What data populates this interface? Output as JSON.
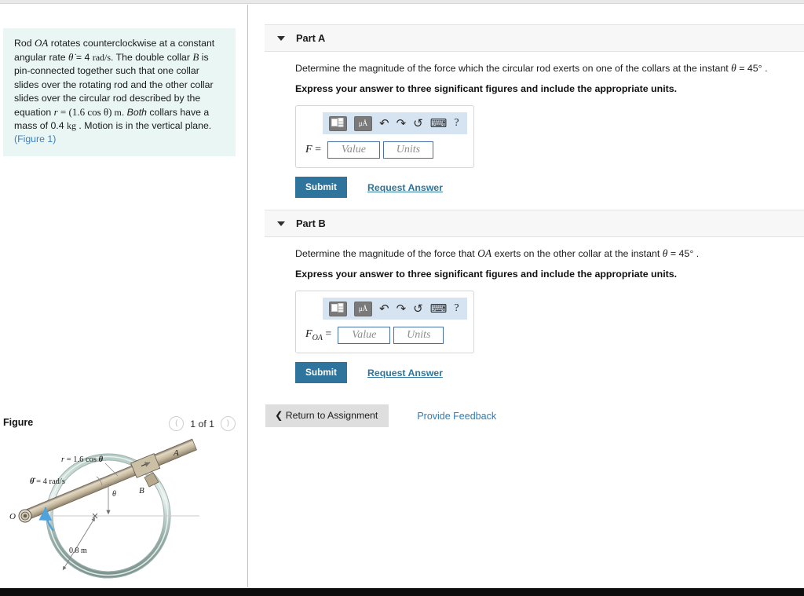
{
  "problem": {
    "text_parts": [
      {
        "t": "Rod ",
        "k": "plain"
      },
      {
        "t": "OA",
        "k": "mi"
      },
      {
        "t": " rotates counterclockwise at a constant angular rate ",
        "k": "plain"
      },
      {
        "t": "θ̇",
        "k": "mi"
      },
      {
        "t": " = 4 ",
        "k": "plain"
      },
      {
        "t": "rad/s",
        "k": "mu"
      },
      {
        "t": ". The double collar ",
        "k": "plain"
      },
      {
        "t": "B",
        "k": "mi"
      },
      {
        "t": " is pin-connected together such that one collar slides over the rotating rod and the other collar slides over the circular rod described by the equation ",
        "k": "plain"
      },
      {
        "t": "r",
        "k": "mi"
      },
      {
        "t": " = ",
        "k": "mn"
      },
      {
        "t": "(1.6 cos θ)",
        "k": "mn"
      },
      {
        "t": " m",
        "k": "mu"
      },
      {
        "t": ". ",
        "k": "plain"
      },
      {
        "t": "Both",
        "k": "em"
      },
      {
        "t": " collars have a mass of 0.4 ",
        "k": "plain"
      },
      {
        "t": "kg",
        "k": "mu"
      },
      {
        "t": " . Motion is in the vertical plane. ",
        "k": "plain"
      }
    ],
    "figure_link": "(Figure 1)"
  },
  "figure": {
    "title": "Figure",
    "counter": "1 of 1",
    "prev_icon": "chevron-left-icon",
    "next_icon": "chevron-right-icon",
    "labels": {
      "equation": "r = 1.6 cos θ",
      "angular_rate": "θ̇ = 4 rad/s",
      "origin": "O",
      "point_a": "A",
      "point_b": "B",
      "theta": "θ",
      "radius": "0.8 m"
    },
    "colors": {
      "ring_outer": "#8fa9a3",
      "ring_inner": "#d6e3de",
      "rod_fill": "#cbbfa5",
      "rod_edge": "#6b6050",
      "arrow_blue": "#4ea3dd"
    }
  },
  "parts": [
    {
      "id": "part-a",
      "label": "Part A",
      "caret_icon": "caret-down-icon",
      "question_parts": [
        {
          "t": "Determine the magnitude of the force which the circular rod exerts on one of the collars at the instant ",
          "k": "plain"
        },
        {
          "t": "θ",
          "k": "mi"
        },
        {
          "t": " = 45° .",
          "k": "plain"
        }
      ],
      "instruction": "Express your answer to three significant figures and include the appropriate units.",
      "variable": "F",
      "variable_sub": "",
      "equals": "=",
      "value_placeholder": "Value",
      "units_placeholder": "Units",
      "value": "",
      "units": "",
      "submit_label": "Submit",
      "request_answer_label": "Request Answer",
      "toolbar": [
        {
          "name": "template-layout-icon",
          "glyph": "",
          "kind": "tile"
        },
        {
          "name": "units-micro-angstrom-icon",
          "glyph": "μÅ",
          "kind": "tile"
        },
        {
          "name": "undo-icon",
          "glyph": "↶",
          "kind": "glyph"
        },
        {
          "name": "redo-icon",
          "glyph": "↷",
          "kind": "glyph"
        },
        {
          "name": "reset-icon",
          "glyph": "↺",
          "kind": "glyph"
        },
        {
          "name": "keyboard-icon",
          "glyph": "⌨",
          "kind": "glyph"
        },
        {
          "name": "help-icon",
          "glyph": "?",
          "kind": "help"
        }
      ]
    },
    {
      "id": "part-b",
      "label": "Part B",
      "caret_icon": "caret-down-icon",
      "question_parts": [
        {
          "t": "Determine the magnitude of the force that ",
          "k": "plain"
        },
        {
          "t": "OA",
          "k": "mi"
        },
        {
          "t": " exerts on the other collar at the instant ",
          "k": "plain"
        },
        {
          "t": "θ",
          "k": "mi"
        },
        {
          "t": " = 45° .",
          "k": "plain"
        }
      ],
      "instruction": "Express your answer to three significant figures and include the appropriate units.",
      "variable": "F",
      "variable_sub": "OA",
      "equals": "=",
      "value_placeholder": "Value",
      "units_placeholder": "Units",
      "value": "",
      "units": "",
      "submit_label": "Submit",
      "request_answer_label": "Request Answer",
      "toolbar": [
        {
          "name": "template-layout-icon",
          "glyph": "",
          "kind": "tile"
        },
        {
          "name": "units-micro-angstrom-icon",
          "glyph": "μÅ",
          "kind": "tile"
        },
        {
          "name": "undo-icon",
          "glyph": "↶",
          "kind": "glyph"
        },
        {
          "name": "redo-icon",
          "glyph": "↷",
          "kind": "glyph"
        },
        {
          "name": "reset-icon",
          "glyph": "↺",
          "kind": "glyph"
        },
        {
          "name": "keyboard-icon",
          "glyph": "⌨",
          "kind": "glyph"
        },
        {
          "name": "help-icon",
          "glyph": "?",
          "kind": "help"
        }
      ]
    }
  ],
  "footer": {
    "return_label": "Return to Assignment",
    "return_icon": "chevron-left-icon",
    "feedback_label": "Provide Feedback"
  },
  "colors": {
    "accent_blue": "#2e749c",
    "link_blue": "#2e7bb5",
    "problem_bg": "#e9f6f4",
    "part_header_bg": "#f7f7f7",
    "toolbar_bg": "#d6e4f2",
    "input_border": "#4a6ea9"
  }
}
